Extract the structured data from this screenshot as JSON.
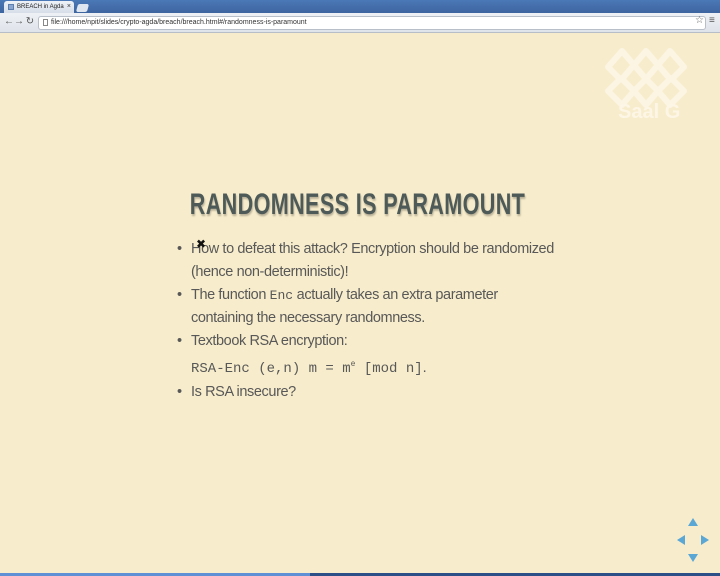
{
  "browser": {
    "tab_title": "BREACH in Agda",
    "tab_close": "×",
    "url": "file:///home/npit/slides/crypto-agda/breach/breach.html#/randomness-is-paramount",
    "icons": {
      "back": "arrow-left",
      "forward": "arrow-right",
      "reload": "reload",
      "bookmark": "star",
      "menu": "hamburger"
    }
  },
  "slide": {
    "logo_text": "Saal G",
    "title": "RANDOMNESS IS PARAMOUNT",
    "bullets": [
      {
        "text": "How to defeat this attack? Encryption should be randomized (hence non-deterministic)!"
      },
      {
        "pre": "The function ",
        "code": "Enc",
        "post": " actually takes an extra parameter containing the necessary randomness."
      },
      {
        "line1": "Textbook RSA encryption:",
        "code": "RSA-Enc (e,n) m = m",
        "sup": "e",
        "code_after": " [mod n]",
        "end": "."
      },
      {
        "text": "Is RSA insecure?"
      }
    ]
  },
  "colors": {
    "background": "#f7eccb",
    "title": "#4d5a58",
    "text": "#585858",
    "nav": "#5aa7d6",
    "tabbar": "#4b78b6"
  }
}
